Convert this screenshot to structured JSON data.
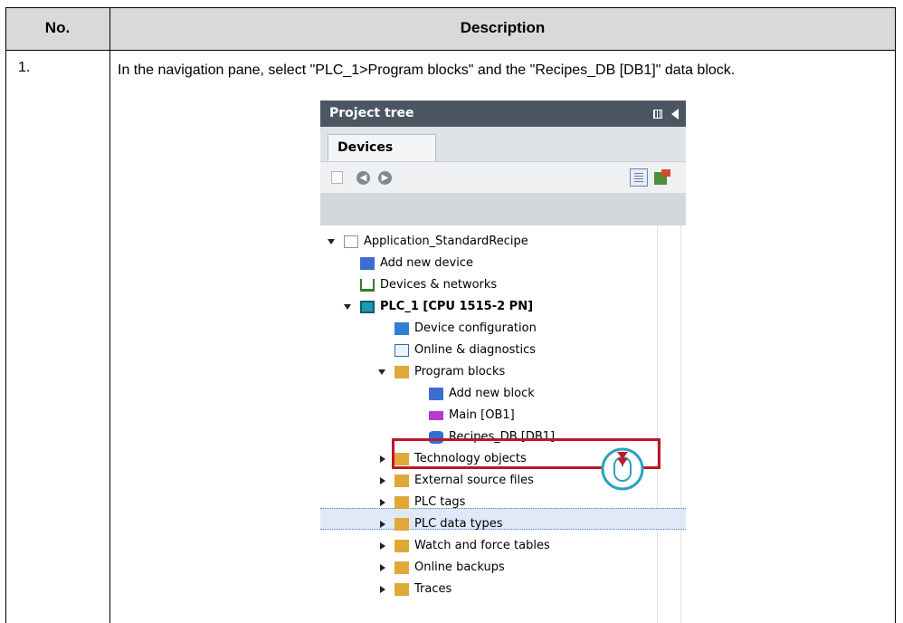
{
  "table": {
    "header": {
      "no": "No.",
      "description": "Description"
    },
    "rows": [
      {
        "no": "1.",
        "text": "In the navigation pane, select \"PLC_1>Program blocks\" and the \"Recipes_DB [DB1]\" data block."
      }
    ]
  },
  "screenshot": {
    "title": "Project tree",
    "tab": "Devices",
    "tree": [
      {
        "label": "Application_StandardRecipe",
        "icon": "project-icon"
      },
      {
        "label": "Add new device",
        "icon": "add-device-icon"
      },
      {
        "label": "Devices & networks",
        "icon": "network-icon"
      },
      {
        "label": "PLC_1 [CPU 1515-2 PN]",
        "icon": "plc-icon"
      },
      {
        "label": "Device configuration",
        "icon": "device-config-icon"
      },
      {
        "label": "Online & diagnostics",
        "icon": "diagnostics-icon"
      },
      {
        "label": "Program blocks",
        "icon": "folder-icon"
      },
      {
        "label": "Add new block",
        "icon": "add-block-icon"
      },
      {
        "label": "Main [OB1]",
        "icon": "ob-block-icon"
      },
      {
        "label": "Recipes_DB [DB1]",
        "icon": "db-block-icon"
      },
      {
        "label": "Technology objects",
        "icon": "folder-icon"
      },
      {
        "label": "External source files",
        "icon": "folder-icon"
      },
      {
        "label": "PLC tags",
        "icon": "folder-icon"
      },
      {
        "label": "PLC data types",
        "icon": "folder-icon"
      },
      {
        "label": "Watch and force tables",
        "icon": "folder-icon"
      },
      {
        "label": "Online backups",
        "icon": "folder-icon"
      },
      {
        "label": "Traces",
        "icon": "folder-icon"
      }
    ],
    "highlight_color": "#c0162a",
    "selection_color": "#dfe9f7"
  }
}
